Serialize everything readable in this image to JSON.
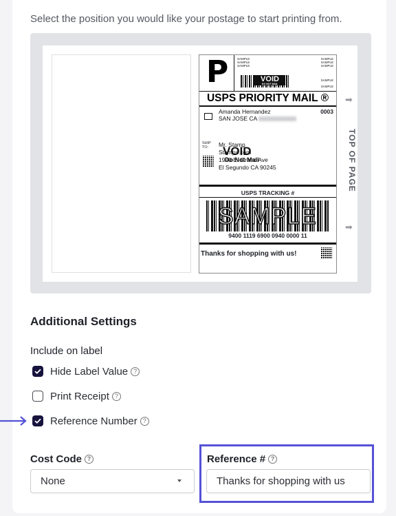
{
  "intro": "Select the position you would like your postage to start printing from.",
  "label": {
    "indicia": "P",
    "indicia_small_left": [
      "SAMPLE",
      "SAMPLE",
      "SAMPLE"
    ],
    "indicia_small_right": [
      "SAMPLE",
      "SAMPLE",
      "SAMPLE",
      "SAMPLE",
      "SAMPLE"
    ],
    "void": "VOID",
    "void_sub": "DO NOT MAIL",
    "service": "USPS PRIORITY MAIL ®",
    "from_name": "Amanda Hernandez",
    "from_city": "SAN JOSE CA",
    "from_number": "0003",
    "ship_to_label": "SHIP TO:",
    "to_name": "Mr. Stamp",
    "to_line2": "Stamps.com",
    "to_line3": "1990 E. Grand Ave",
    "to_line4": "El Segundo CA 90245",
    "void_stamp": "VOID",
    "void_stamp_sub": "Do Not Mail",
    "tracking_title": "USPS TRACKING #",
    "sample_watermark": "SAMPLE",
    "tracking_number": "9400 1119 6900 0940 0000 11",
    "thanks": "Thanks for shopping with us!"
  },
  "top_of_page": "TOP OF PAGE",
  "additional_settings": {
    "title": "Additional Settings",
    "include_title": "Include on label",
    "options": [
      {
        "label": "Hide Label Value",
        "checked": true
      },
      {
        "label": "Print Receipt",
        "checked": false
      },
      {
        "label": "Reference Number",
        "checked": true
      }
    ]
  },
  "cost_code": {
    "label": "Cost Code",
    "value": "None"
  },
  "reference": {
    "label": "Reference #",
    "value": "Thanks for shopping with us"
  },
  "colors": {
    "accent": "#5451d7",
    "checkbox": "#16143d"
  }
}
